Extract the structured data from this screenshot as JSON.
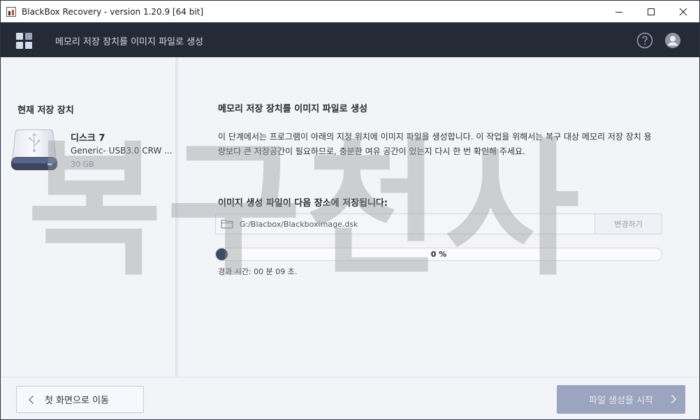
{
  "window": {
    "title": "BlackBox Recovery - version 1.20.9 [64 bit]"
  },
  "header": {
    "title": "메모리 저장 장치를 이미지 파일로 생성"
  },
  "sidebar": {
    "heading": "현재 저장 장치",
    "device": {
      "name": "디스크 7",
      "model": "Generic- USB3.0 CRW   ...",
      "size": "30 GB",
      "icon": "usb-drive-icon"
    }
  },
  "main": {
    "title": "메모리 저장 장치를 이미지 파일로 생성",
    "description": "이 단계에서는 프로그램이 아래의 지정 위치에 이미지 파일을 생성합니다. 이 작업을 위해서는 복구 대상 메모리 저장 장치 용량보다 큰 저장공간이 필요하므로, 충분한 여유 공간이 있는지 다시 한 번 확인해 주세요.",
    "save_heading": "이미지 생성 파일이 다음 장소에 저장됩니다:",
    "path": "G:/Blacbox/Blackboximage.dsk",
    "change_label": "변경하기",
    "progress": {
      "percent": 0,
      "label": "0 %"
    },
    "elapsed": "경과 시간:  00 분  09 초."
  },
  "watermark": "복구천사",
  "footer": {
    "back_label": "첫 화면으로 이동",
    "start_label": "파일 생성을 시작"
  },
  "colors": {
    "header_bg": "#252a37",
    "body_bg": "#f3f4f8",
    "start_button": "#9ba5bf",
    "progress_fill": "#3d4a63"
  }
}
